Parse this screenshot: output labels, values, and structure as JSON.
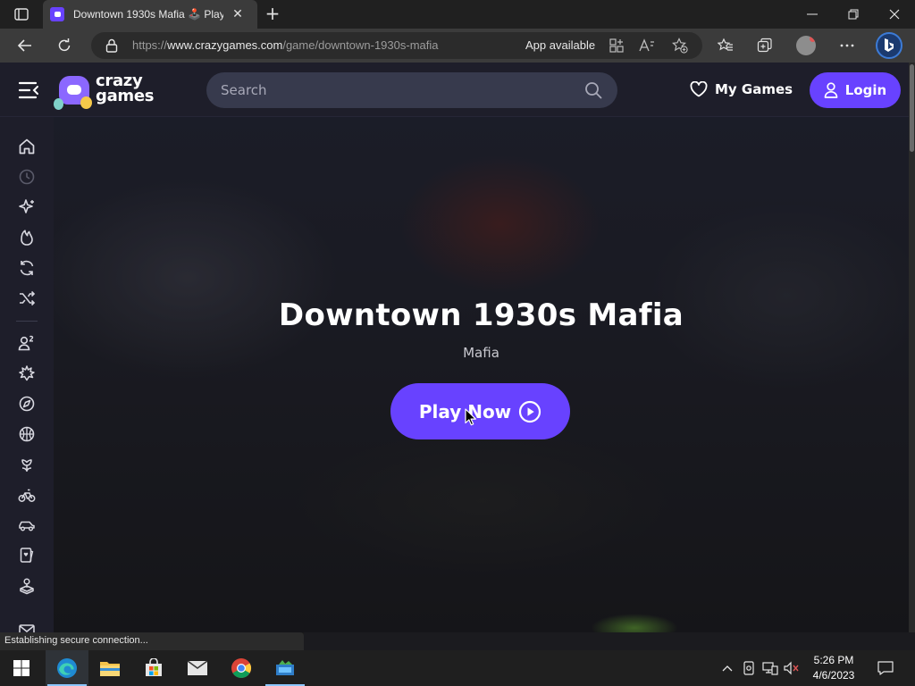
{
  "browser": {
    "tab_title": "Downtown 1930s Mafia 🕹️ Play",
    "url_prefix": "https://",
    "url_domain": "www.crazygames.com",
    "url_path": "/game/downtown-1930s-mafia",
    "app_available": "App available",
    "status_text": "Establishing secure connection..."
  },
  "site": {
    "logo_text_line1": "crazy",
    "logo_text_line2": "games",
    "search_placeholder": "Search",
    "my_games_label": "My Games",
    "login_label": "Login",
    "accent_color": "#6842ff"
  },
  "sidebar": {
    "items": [
      {
        "icon": "home-icon"
      },
      {
        "icon": "recent-icon"
      },
      {
        "icon": "new-icon"
      },
      {
        "icon": "trending-icon"
      },
      {
        "icon": "updated-icon"
      },
      {
        "icon": "random-icon"
      },
      {
        "icon": "multiplayer-icon"
      },
      {
        "icon": "action-icon"
      },
      {
        "icon": "adventure-icon"
      },
      {
        "icon": "basketball-icon"
      },
      {
        "icon": "beauty-icon"
      },
      {
        "icon": "bike-icon"
      },
      {
        "icon": "car-icon"
      },
      {
        "icon": "card-icon"
      },
      {
        "icon": "casual-icon"
      },
      {
        "icon": "mail-icon"
      }
    ]
  },
  "hero": {
    "title": "Downtown 1930s Mafia",
    "genre": "Mafia",
    "play_label": "Play Now"
  },
  "taskbar": {
    "time": "5:26 PM",
    "date": "4/6/2023",
    "apps": [
      "start-icon",
      "edge-icon",
      "file-explorer-icon",
      "store-icon",
      "mail-icon",
      "chrome-icon",
      "app-icon"
    ]
  }
}
